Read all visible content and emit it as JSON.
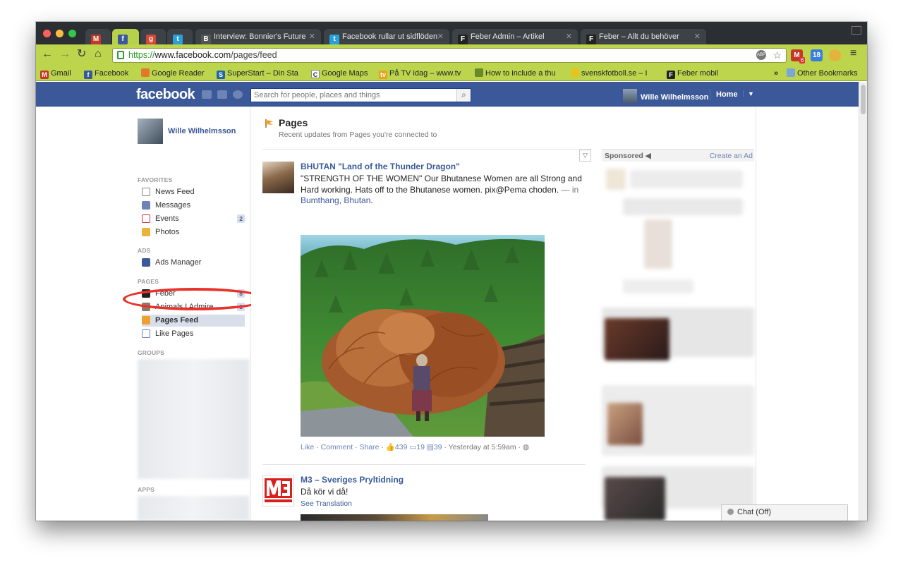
{
  "browser": {
    "tabs": [
      {
        "title": "",
        "icon": "gmail-icon",
        "color": "#c53727"
      },
      {
        "title": "",
        "icon": "facebook-icon",
        "color": "#3b5998",
        "active": true
      },
      {
        "title": "",
        "icon": "google-plus-icon",
        "color": "#d34836"
      },
      {
        "title": "",
        "icon": "twitter-icon",
        "color": "#2a9fd8"
      },
      {
        "title": "Interview: Bonnier's Future",
        "icon": "bonnier-icon",
        "color": "#333333"
      },
      {
        "title": "Facebook rullar ut sidflöden",
        "icon": "twitter-icon",
        "color": "#2a9fd8"
      },
      {
        "title": "Feber Admin – Artikel",
        "icon": "feber-icon",
        "color": "#222222"
      },
      {
        "title": "Feber – Allt du behöver",
        "icon": "feber-icon",
        "color": "#222222"
      }
    ],
    "url": {
      "scheme": "https://",
      "host": "www.facebook.com",
      "path": "/pages/feed"
    },
    "extensions": {
      "gmail_badge": "6",
      "calendar": "18"
    },
    "bookmarks": [
      {
        "label": "Gmail",
        "icon": "gmail-icon"
      },
      {
        "label": "Facebook",
        "icon": "facebook-icon"
      },
      {
        "label": "Google Reader",
        "icon": "google-reader-icon"
      },
      {
        "label": "SuperStart – Din Sta",
        "icon": "superstart-icon"
      },
      {
        "label": "Google Maps",
        "icon": "google-maps-icon"
      },
      {
        "label": "På TV idag – www.tv",
        "icon": "tv-icon"
      },
      {
        "label": "How to include a thu",
        "icon": "android-icon"
      },
      {
        "label": "svenskfotboll.se – I",
        "icon": "football-icon"
      },
      {
        "label": "Feber mobil",
        "icon": "feber-icon"
      }
    ],
    "more": "»",
    "other_bookmarks": "Other Bookmarks"
  },
  "header": {
    "logo": "facebook",
    "search_placeholder": "Search for people, places and things",
    "user_name": "Wille Wilhelmsson",
    "home": "Home"
  },
  "sidebar": {
    "profile_name": "Wille Wilhelmsson",
    "favorites_label": "FAVORITES",
    "favorites": [
      {
        "label": "News Feed",
        "icon": "news-feed-icon"
      },
      {
        "label": "Messages",
        "icon": "messages-icon"
      },
      {
        "label": "Events",
        "icon": "events-icon",
        "count": "2"
      },
      {
        "label": "Photos",
        "icon": "photos-icon"
      }
    ],
    "ads_label": "ADS",
    "ads": [
      {
        "label": "Ads Manager",
        "icon": "ads-manager-icon"
      }
    ],
    "pages_label": "PAGES",
    "pages": [
      {
        "label": "Feber",
        "icon": "feber-page-icon",
        "count": "8"
      },
      {
        "label": "Animals I Admire",
        "icon": "animals-page-icon",
        "count": "1"
      },
      {
        "label": "Pages Feed",
        "icon": "pages-feed-icon",
        "selected": true
      },
      {
        "label": "Like Pages",
        "icon": "like-pages-icon"
      }
    ],
    "groups_label": "GROUPS",
    "apps_label": "APPS"
  },
  "main": {
    "title": "Pages",
    "subtitle": "Recent updates from Pages you're connected to",
    "stories": [
      {
        "author": "BHUTAN \"Land of the Thunder Dragon\"",
        "text": "\"STRENGTH OF THE WOMEN\" Our Bhutanese Women are all Strong and Hard working. Hats off to the Bhutanese women. pix@Pema choden.",
        "with": " — in ",
        "location": "Bumthang, Bhutan",
        "location_end": ".",
        "actions": {
          "like": "Like",
          "comment": "Comment",
          "share": "Share",
          "likes": "439",
          "comments": "19",
          "shares": "39",
          "time": "Yesterday at 5:59am"
        }
      },
      {
        "author": "M3 – Sveriges Pryltidning",
        "text": "Då kör vi då!",
        "see_translation": "See Translation"
      }
    ]
  },
  "ads": {
    "sponsored": "Sponsored",
    "create_ad": "Create an Ad"
  },
  "chat": {
    "label": "Chat (Off)"
  },
  "colors": {
    "facebook_blue": "#3b5998",
    "chrome_green": "#bcd54d",
    "highlight_red": "#e8322a"
  }
}
